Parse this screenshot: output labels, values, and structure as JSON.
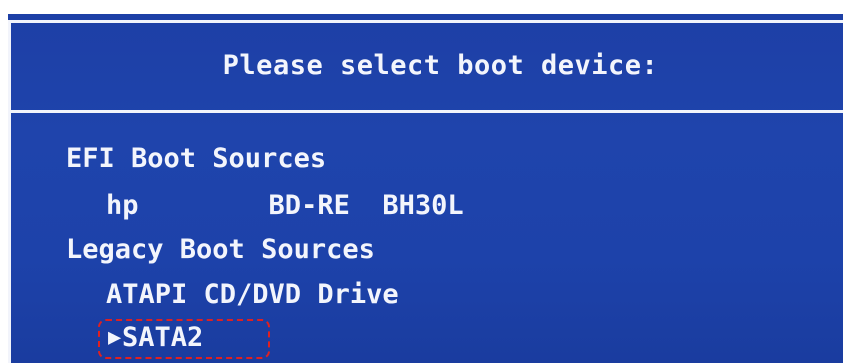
{
  "bios": {
    "title": "Please select boot device:",
    "efi_heading": "EFI Boot Sources",
    "efi_device": "hp        BD-RE  BH30L",
    "legacy_heading": "Legacy Boot Sources",
    "legacy_device_1": "ATAPI CD/DVD Drive",
    "legacy_device_2": "SATA2",
    "selected_marker": "▶"
  },
  "colors": {
    "background": "#1f44ac",
    "text": "#f3f5fc",
    "frame": "#f2f4fb",
    "highlight": "#e02020"
  }
}
